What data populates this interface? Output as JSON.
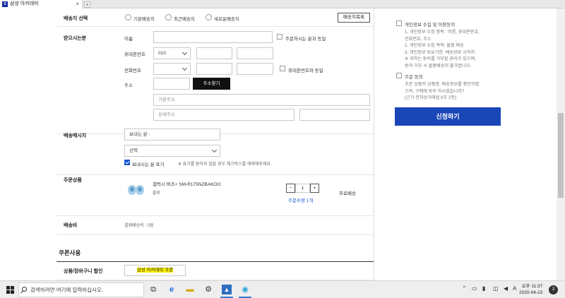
{
  "browser": {
    "tab_title": "삼성 아카데미",
    "close_glyph": "×",
    "new_tab_glyph": "+"
  },
  "shipping_select": {
    "label": "배송지 선택",
    "options": [
      "기본배송지",
      "최근배송지",
      "새로운배송지"
    ],
    "list_button": "배송지목록"
  },
  "recipient": {
    "label": "받으시는분",
    "name_label": "이름",
    "same_as_orderer": "주문하시는 분과 동일",
    "mobile_label": "휴대폰번호",
    "mobile_prefix": "010",
    "phone_label": "전화번호",
    "same_as_mobile": "휴대폰번호와 동일",
    "address_label": "주소",
    "find_address_button": "주소찾기",
    "basic_address_placeholder": "기본주소",
    "detail_address_placeholder": "상세주소"
  },
  "delivery_message": {
    "label": "배송메시지",
    "sender_value": "보내는 분 :",
    "select_value": "선택",
    "show_sender_label": "보내시는 분 표기",
    "note": "※ 표기를 원하지 않을 경우 체크박스를 해제해주세요."
  },
  "order_product": {
    "label": "주문상품",
    "name": "갤럭시 버즈+ SM-R175NZBAKOO",
    "color": "블루",
    "quantity": "1",
    "minus": "−",
    "plus": "+",
    "order_qty": "주문수량 1개",
    "shipping": "무료배송"
  },
  "shipping_fee": {
    "label": "배송비",
    "value": "결제배송비 : 0원"
  },
  "coupon": {
    "title": "쿠폰사용",
    "row_label": "상품/장바구니 할인",
    "value": "삼성 아카데미 쿠폰"
  },
  "consent": {
    "privacy_title": "개인정보 수집 및 이용동의",
    "privacy_lines": [
      "1. 개인정보 수집 항목 : 이름, 휴대폰번호,",
      "전화번호, 주소",
      "2. 개인정보 수집 목적: 물품 배송",
      "3. 개인정보 보유기한: 배송완료 시까지",
      "※ 귀하는 동의를 거부할 권리가 있으며,",
      "동의 거부 시 물품배송이 불가합니다."
    ],
    "order_title": "주문 동의",
    "order_lines": [
      "주문 상품의 상품명, 배송정보를 확인하였",
      "으며, 구매에 동의 하시겠습니까?",
      "(근거 전자상거래법 8조 2항)"
    ],
    "apply_button": "신청하기"
  },
  "taskbar": {
    "search_placeholder": "검색하려면 여기에 입력하십시오.",
    "ime": "A",
    "time_ampm": "오후 11:37",
    "date": "2020-04-23",
    "notification_count": "3"
  }
}
